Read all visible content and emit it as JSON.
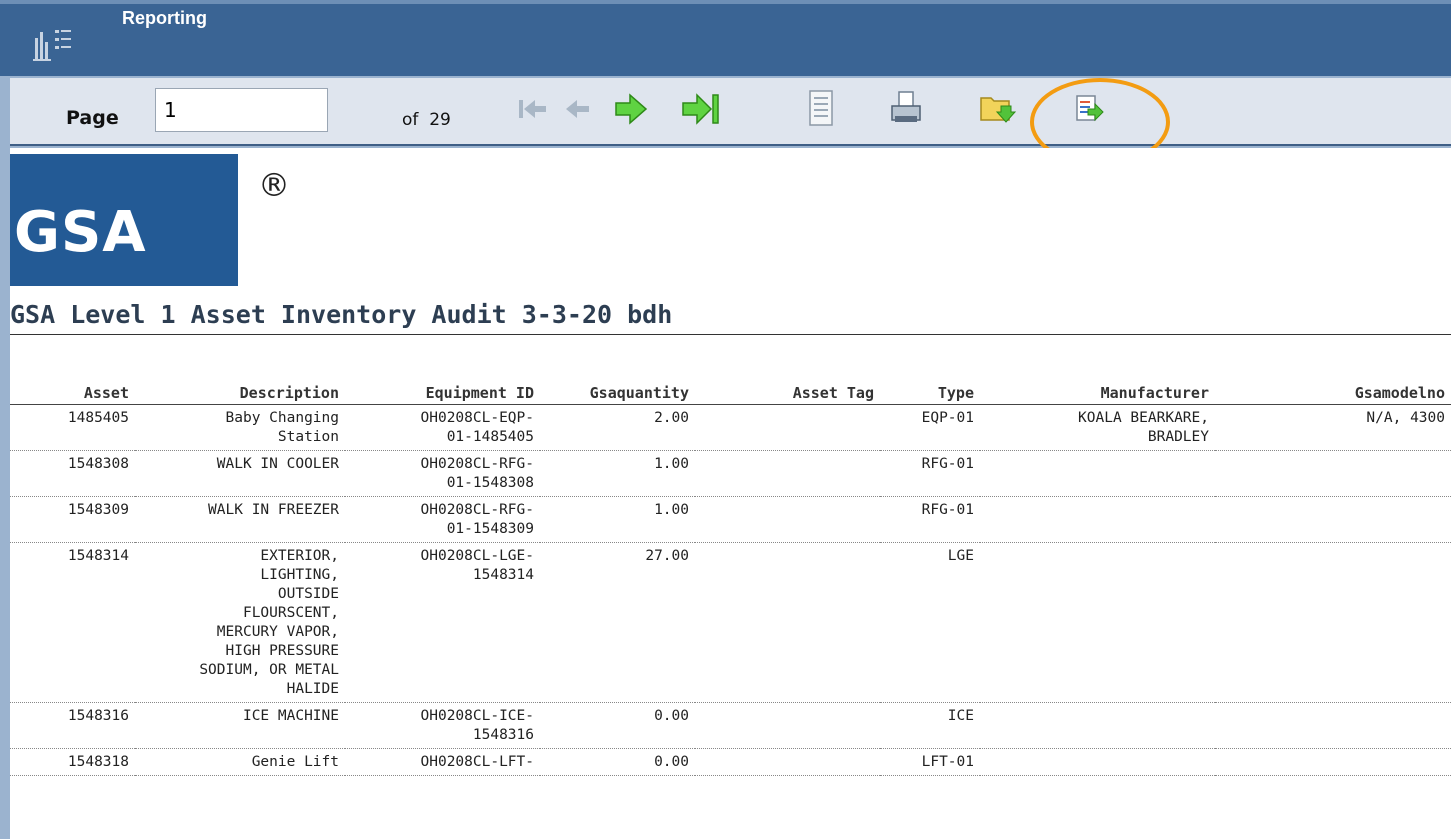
{
  "app": {
    "title": "Reporting",
    "icon": "report-icon"
  },
  "toolbar": {
    "page_label": "Page",
    "page_value": "1",
    "of_label": "of",
    "total_pages": "29",
    "icons": [
      "first-page-icon",
      "previous-page-icon",
      "next-page-icon",
      "last-page-icon",
      "document-map-icon",
      "print-icon",
      "export-icon",
      "export-data-icon"
    ],
    "highlight_color": "#f39c12"
  },
  "report": {
    "logo_text": "GSA",
    "registered_mark": "®",
    "title": "GSA Level 1 Asset Inventory Audit 3-3-20 bdh",
    "columns": [
      "Asset",
      "Description",
      "Equipment ID",
      "Gsaquantity",
      "Asset Tag",
      "Type",
      "Manufacturer",
      "Gsamodelno"
    ],
    "rows": [
      {
        "asset": "1485405",
        "description": [
          "Baby Changing",
          "Station"
        ],
        "equipment_id": [
          "OH0208CL-EQP-",
          "01-1485405"
        ],
        "quantity": "2.00",
        "asset_tag": "",
        "type": "EQP-01",
        "manufacturer": [
          "KOALA BEARKARE,",
          "BRADLEY"
        ],
        "model": "N/A, 4300"
      },
      {
        "asset": "1548308",
        "description": [
          "WALK IN COOLER"
        ],
        "equipment_id": [
          "OH0208CL-RFG-",
          "01-1548308"
        ],
        "quantity": "1.00",
        "asset_tag": "",
        "type": "RFG-01",
        "manufacturer": [],
        "model": ""
      },
      {
        "asset": "1548309",
        "description": [
          "WALK IN FREEZER"
        ],
        "equipment_id": [
          "OH0208CL-RFG-",
          "01-1548309"
        ],
        "quantity": "1.00",
        "asset_tag": "",
        "type": "RFG-01",
        "manufacturer": [],
        "model": ""
      },
      {
        "asset": "1548314",
        "description": [
          "EXTERIOR,",
          "LIGHTING,",
          "OUTSIDE",
          "FLOURSCENT,",
          "MERCURY VAPOR,",
          "HIGH PRESSURE",
          "SODIUM, OR METAL",
          "HALIDE"
        ],
        "equipment_id": [
          "OH0208CL-LGE-",
          "1548314"
        ],
        "quantity": "27.00",
        "asset_tag": "",
        "type": "LGE",
        "manufacturer": [],
        "model": ""
      },
      {
        "asset": "1548316",
        "description": [
          "ICE MACHINE"
        ],
        "equipment_id": [
          "OH0208CL-ICE-",
          "1548316"
        ],
        "quantity": "0.00",
        "asset_tag": "",
        "type": "ICE",
        "manufacturer": [],
        "model": ""
      },
      {
        "asset": "1548318",
        "description": [
          "Genie Lift"
        ],
        "equipment_id": [
          "OH0208CL-LFT-"
        ],
        "quantity": "0.00",
        "asset_tag": "",
        "type": "LFT-01",
        "manufacturer": [],
        "model": ""
      }
    ]
  }
}
